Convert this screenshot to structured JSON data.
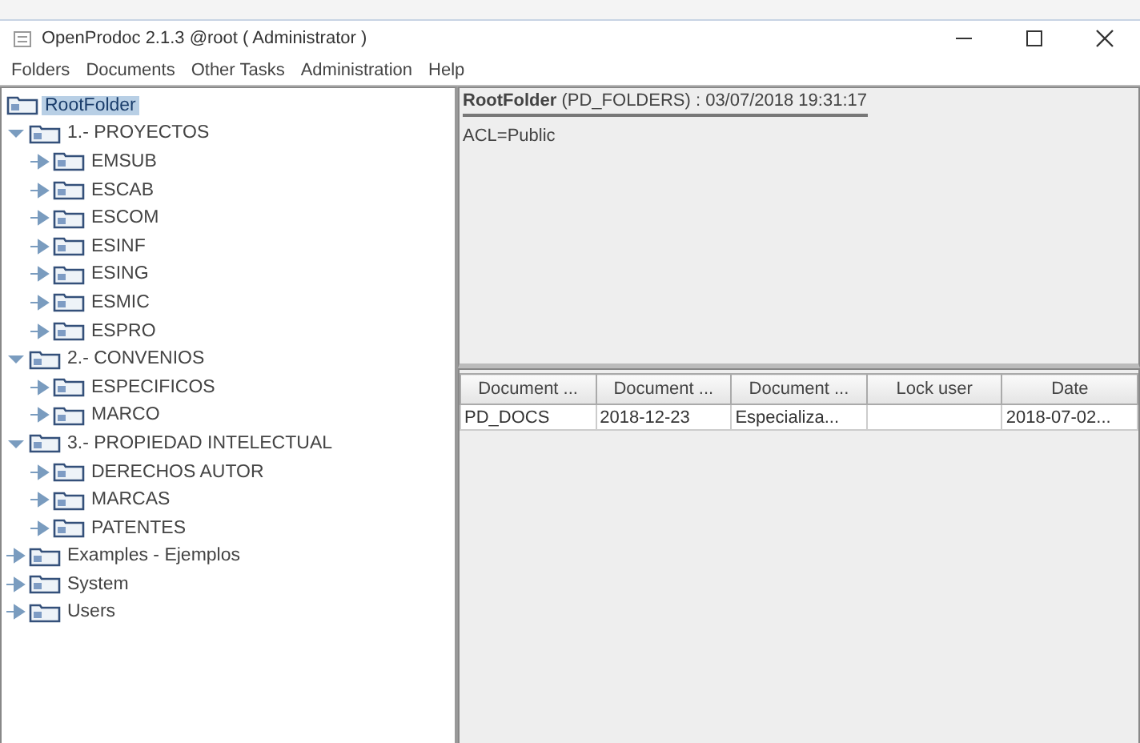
{
  "window": {
    "title": "OpenProdoc 2.1.3 @root ( Administrator )"
  },
  "menu": [
    "Folders",
    "Documents",
    "Other Tasks",
    "Administration",
    "Help"
  ],
  "tree": [
    {
      "label": "RootFolder",
      "selected": true,
      "children": [
        {
          "label": "1.- PROYECTOS",
          "selected": false,
          "expanded": true,
          "children": [
            {
              "label": "EMSUB",
              "selected": false,
              "expanded": false
            },
            {
              "label": "ESCAB",
              "selected": false,
              "expanded": false
            },
            {
              "label": "ESCOM",
              "selected": false,
              "expanded": false
            },
            {
              "label": "ESINF",
              "selected": false,
              "expanded": false
            },
            {
              "label": "ESING",
              "selected": false,
              "expanded": false
            },
            {
              "label": "ESMIC",
              "selected": false,
              "expanded": false
            },
            {
              "label": "ESPRO",
              "selected": false,
              "expanded": false
            }
          ]
        },
        {
          "label": "2.- CONVENIOS",
          "selected": false,
          "expanded": true,
          "children": [
            {
              "label": "ESPECIFICOS",
              "selected": false,
              "expanded": false
            },
            {
              "label": "MARCO",
              "selected": false,
              "expanded": false
            }
          ]
        },
        {
          "label": "3.- PROPIEDAD INTELECTUAL",
          "selected": false,
          "expanded": true,
          "children": [
            {
              "label": "DERECHOS AUTOR",
              "selected": false,
              "expanded": false
            },
            {
              "label": "MARCAS",
              "selected": false,
              "expanded": false
            },
            {
              "label": "PATENTES",
              "selected": false,
              "expanded": false
            }
          ]
        },
        {
          "label": "Examples - Ejemplos",
          "selected": false,
          "expanded": false
        },
        {
          "label": "System",
          "selected": false,
          "expanded": false
        },
        {
          "label": "Users",
          "selected": false,
          "expanded": false
        }
      ]
    }
  ],
  "folder_info": {
    "heading": "**RootFolder** (PD_FOLDERS) : 03/07/2018 19:31:17",
    "acl": "ACL=Public"
  },
  "table": {
    "columns": [
      "Document ...",
      "Document ...",
      "Document ...",
      "Lock user",
      "Date"
    ],
    "rows": [
      {
        "selected": false,
        "cells": [
          "PD_DOCS",
          "2018-12-23",
          "Especializa...",
          null,
          "2018-07-02..."
        ]
      }
    ]
  }
}
